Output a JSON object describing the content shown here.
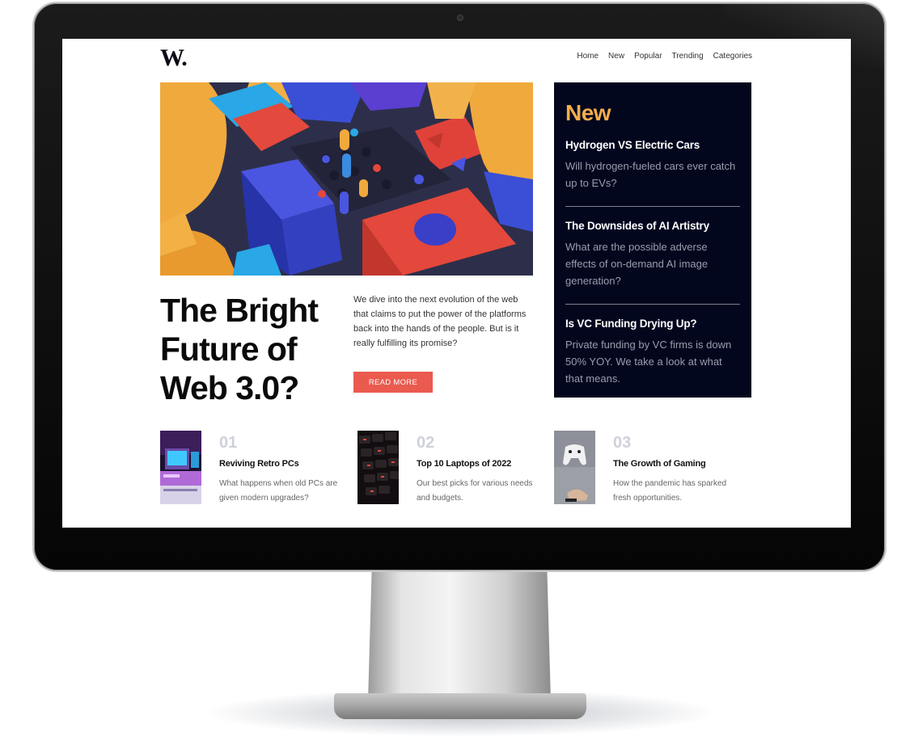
{
  "site": {
    "logo": "W.",
    "nav": [
      "Home",
      "New",
      "Popular",
      "Trending",
      "Categories"
    ]
  },
  "hero": {
    "title": "The Bright Future of Web 3.0?",
    "description": "We dive into the next evolution of the web that claims to put the power of the platforms back into the hands of the people. But is it really fulfilling its promise?",
    "button": "READ MORE"
  },
  "new_panel": {
    "heading": "New",
    "items": [
      {
        "title": "Hydrogen VS Electric Cars",
        "desc": "Will hydrogen-fueled cars ever catch up to EVs?"
      },
      {
        "title": "The Downsides of AI Artistry",
        "desc": "What are the possible adverse effects of on-demand AI image generation?"
      },
      {
        "title": "Is VC Funding Drying Up?",
        "desc": "Private funding by VC firms is down 50% YOY. We take a look at what that means."
      }
    ]
  },
  "cards": [
    {
      "num": "01",
      "title": "Reviving Retro PCs",
      "desc": "What happens when old PCs are given modern upgrades?"
    },
    {
      "num": "02",
      "title": "Top 10 Laptops of 2022",
      "desc": "Our best picks for various needs and budgets."
    },
    {
      "num": "03",
      "title": "The Growth of Gaming",
      "desc": "How the pandemic has sparked fresh opportunities."
    }
  ],
  "colors": {
    "accent": "#ea5a4f",
    "panel_bg": "#03071e",
    "panel_heading": "#f4ad4c"
  }
}
